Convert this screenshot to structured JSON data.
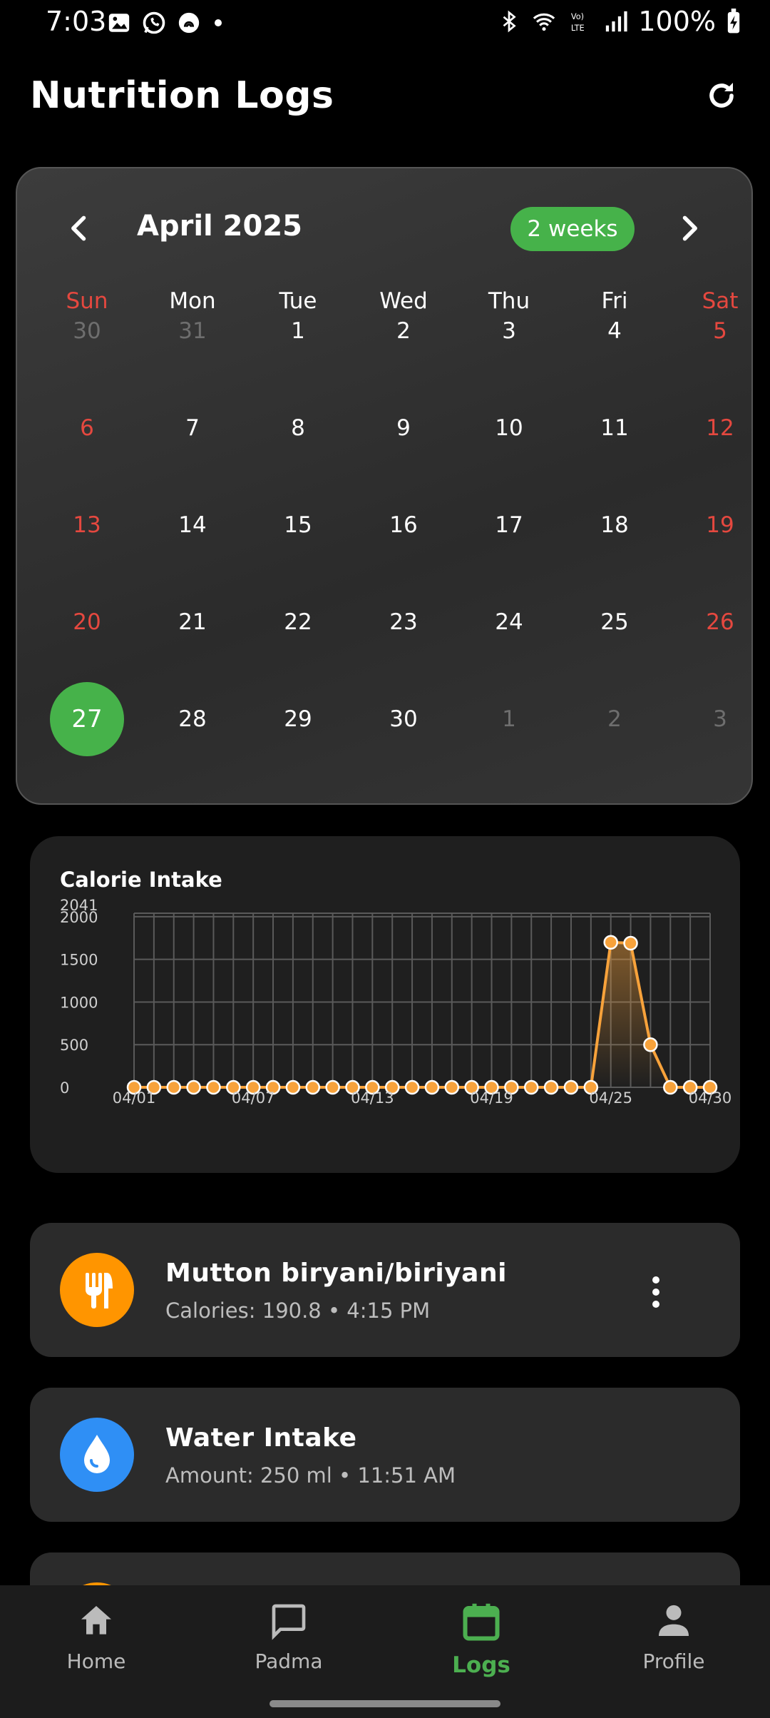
{
  "status": {
    "time": "7:03",
    "battery": "100%"
  },
  "header": {
    "title": "Nutrition Logs"
  },
  "calendar": {
    "month": "April 2025",
    "range_label": "2 weeks",
    "weekdays": [
      "Sun",
      "Mon",
      "Tue",
      "Wed",
      "Thu",
      "Fri",
      "Sat"
    ],
    "days": [
      [
        "30",
        "31",
        "1",
        "2",
        "3",
        "4",
        "5"
      ],
      [
        "6",
        "7",
        "8",
        "9",
        "10",
        "11",
        "12"
      ],
      [
        "13",
        "14",
        "15",
        "16",
        "17",
        "18",
        "19"
      ],
      [
        "20",
        "21",
        "22",
        "23",
        "24",
        "25",
        "26"
      ],
      [
        "27",
        "28",
        "29",
        "30",
        "1",
        "2",
        "3"
      ]
    ],
    "selected_day": "27"
  },
  "chart_data": {
    "type": "line",
    "title": "Calorie Intake",
    "y_ticks": [
      "2041",
      "2000",
      "1500",
      "1000",
      "500",
      "0"
    ],
    "x_tick_labels": [
      "04/01",
      "04/07",
      "04/13",
      "04/19",
      "04/25",
      "04/30"
    ],
    "x": [
      "04/01",
      "04/02",
      "04/03",
      "04/04",
      "04/05",
      "04/06",
      "04/07",
      "04/08",
      "04/09",
      "04/10",
      "04/11",
      "04/12",
      "04/13",
      "04/14",
      "04/15",
      "04/16",
      "04/17",
      "04/18",
      "04/19",
      "04/20",
      "04/21",
      "04/22",
      "04/23",
      "04/24",
      "04/25",
      "04/26",
      "04/27",
      "04/28",
      "04/29",
      "04/30"
    ],
    "values": [
      0,
      0,
      0,
      0,
      0,
      0,
      0,
      0,
      0,
      0,
      0,
      0,
      0,
      0,
      0,
      0,
      0,
      0,
      0,
      0,
      0,
      0,
      0,
      0,
      1700,
      1690,
      500,
      0,
      0,
      0
    ],
    "ylim": [
      0,
      2041
    ],
    "grid": true,
    "line_color": "#f7a23b"
  },
  "logs": [
    {
      "title": "Mutton biryani/biriyani",
      "subtitle": "Calories: 190.8 • 4:15 PM",
      "icon": "restaurant-icon",
      "color": "#ff9500"
    },
    {
      "title": "Water Intake",
      "subtitle": "Amount: 250 ml • 11:51 AM",
      "icon": "water-drop-icon",
      "color": "#2f8ff5"
    }
  ],
  "nav": [
    {
      "label": "Home"
    },
    {
      "label": "Padma"
    },
    {
      "label": "Logs"
    },
    {
      "label": "Profile"
    }
  ]
}
